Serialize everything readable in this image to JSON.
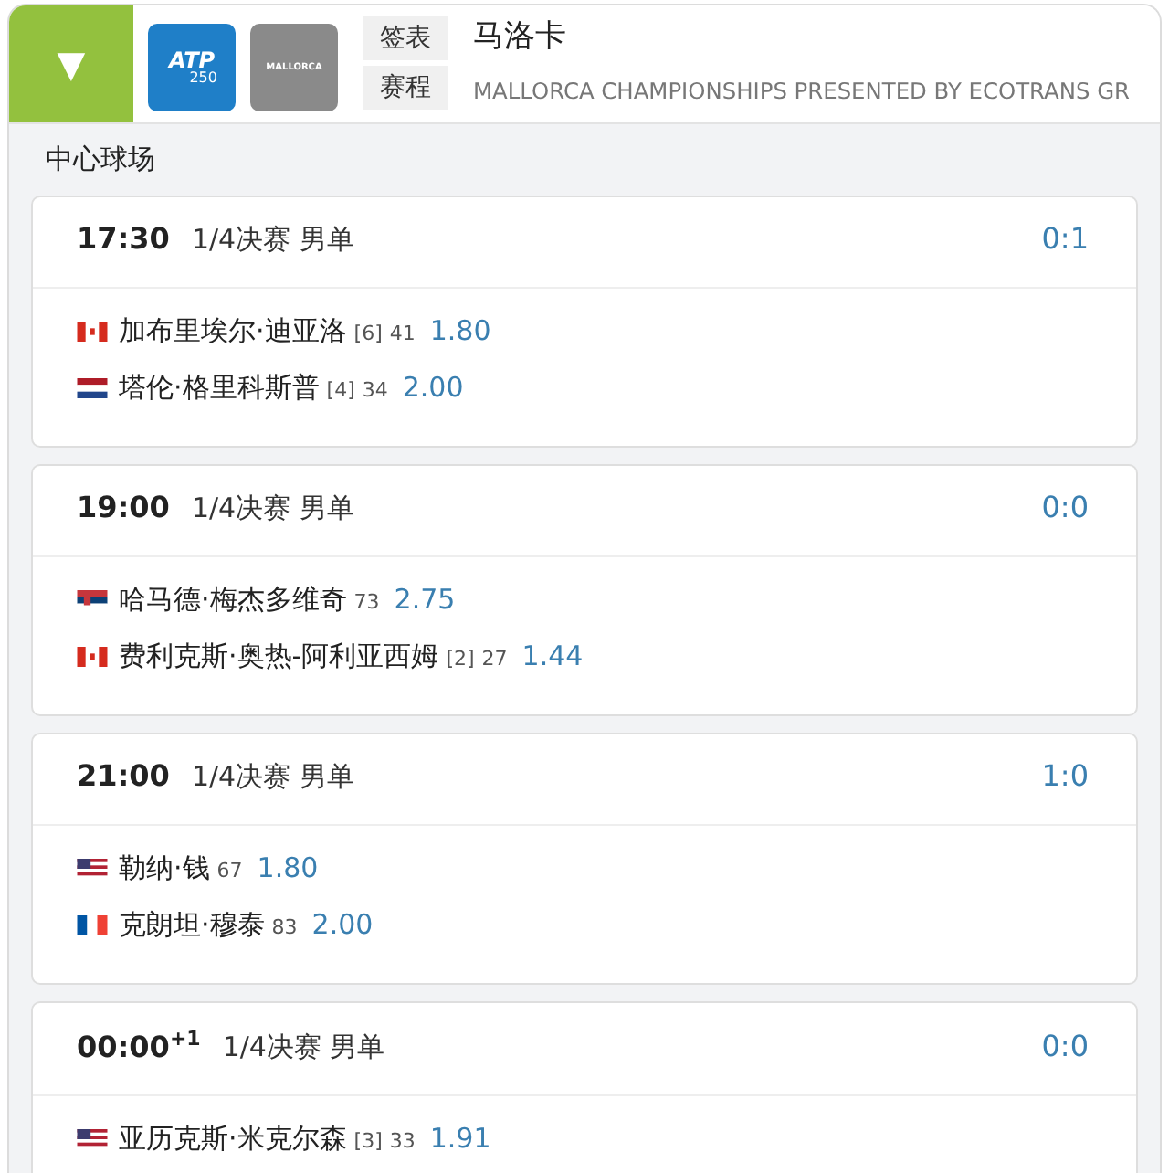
{
  "header": {
    "toggle": "▼",
    "logos": [
      {
        "kind": "atp",
        "text": "ATP",
        "sub": "250"
      },
      {
        "kind": "tournament",
        "text": "MALLORCA"
      }
    ],
    "tabs": [
      {
        "label": "签表",
        "selected": false
      },
      {
        "label": "赛程",
        "selected": false
      }
    ],
    "title": "马洛卡",
    "subtitle": "MALLORCA CHAMPIONSHIPS PRESENTED BY ECOTRANS GR"
  },
  "court": "中心球场",
  "matches": [
    {
      "time": "17:30",
      "round": "1/4决赛 男单",
      "score": "0:1",
      "players": [
        {
          "kind": "ca",
          "name": "加布里埃尔·迪亚洛",
          "seed": "[6]",
          "rank": "41",
          "odds": "1.80"
        },
        {
          "kind": "nl",
          "name": "塔伦·格里科斯普",
          "seed": "[4]",
          "rank": "34",
          "odds": "2.00"
        }
      ]
    },
    {
      "time": "19:00",
      "round": "1/4决赛 男单",
      "score": "0:0",
      "players": [
        {
          "kind": "rs",
          "name": "哈马德·梅杰多维奇",
          "rank": "73",
          "odds": "2.75"
        },
        {
          "kind": "ca",
          "name": "费利克斯·奥热-阿利亚西姆",
          "seed": "[2]",
          "rank": "27",
          "odds": "1.44"
        }
      ]
    },
    {
      "time": "21:00",
      "round": "1/4决赛 男单",
      "score": "1:0",
      "players": [
        {
          "kind": "us",
          "name": "勒纳·钱",
          "rank": "67",
          "odds": "1.80"
        },
        {
          "kind": "fr",
          "name": "克朗坦·穆泰",
          "rank": "83",
          "odds": "2.00"
        }
      ]
    },
    {
      "time": "00:00$^{+1}$",
      "round": "1/4决赛 男单",
      "score": "0:0",
      "players": [
        {
          "kind": "us",
          "name": "亚历克斯·米克尔森",
          "seed": "[3]",
          "rank": "33",
          "odds": "1.91"
        }
      ]
    }
  ]
}
